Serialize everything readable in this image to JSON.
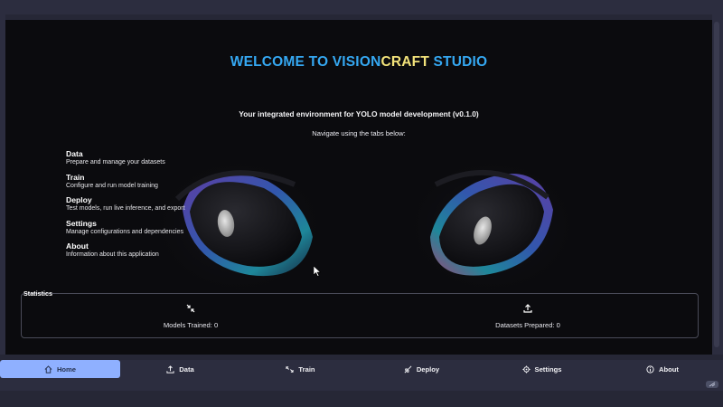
{
  "welcome": {
    "part1": "WELCOME TO VISION",
    "part2": "CRAFT",
    "part3": " STUDIO"
  },
  "subtitle": "Your integrated environment for YOLO model development (v0.1.0)",
  "nav_hint": "Navigate using the tabs below:",
  "tab_info": [
    {
      "name": "Data",
      "desc": "Prepare and manage your datasets"
    },
    {
      "name": "Train",
      "desc": "Configure and run model training"
    },
    {
      "name": "Deploy",
      "desc": "Test models, run live inference, and export"
    },
    {
      "name": "Settings",
      "desc": "Manage configurations and dependencies"
    },
    {
      "name": "About",
      "desc": "Information about this application"
    }
  ],
  "statistics": {
    "label": "Statistics",
    "models_trained": "Models Trained: 0",
    "datasets_prepared": "Datasets Prepared: 0"
  },
  "navbar": {
    "home": "Home",
    "data": "Data",
    "train": "Train",
    "deploy": "Deploy",
    "settings": "Settings",
    "about": "About"
  },
  "colors": {
    "accent_blue": "#35a8f2",
    "accent_yellow": "#f2e27a",
    "active_tab": "#8fb0ff",
    "panel": "#2c2d3f",
    "background": "#0b0b0e"
  },
  "icons": [
    "compress-arrows-icon",
    "upload-icon",
    "home-icon",
    "upload-icon",
    "train-icon",
    "rocket-icon",
    "gear-icon",
    "info-icon"
  ]
}
